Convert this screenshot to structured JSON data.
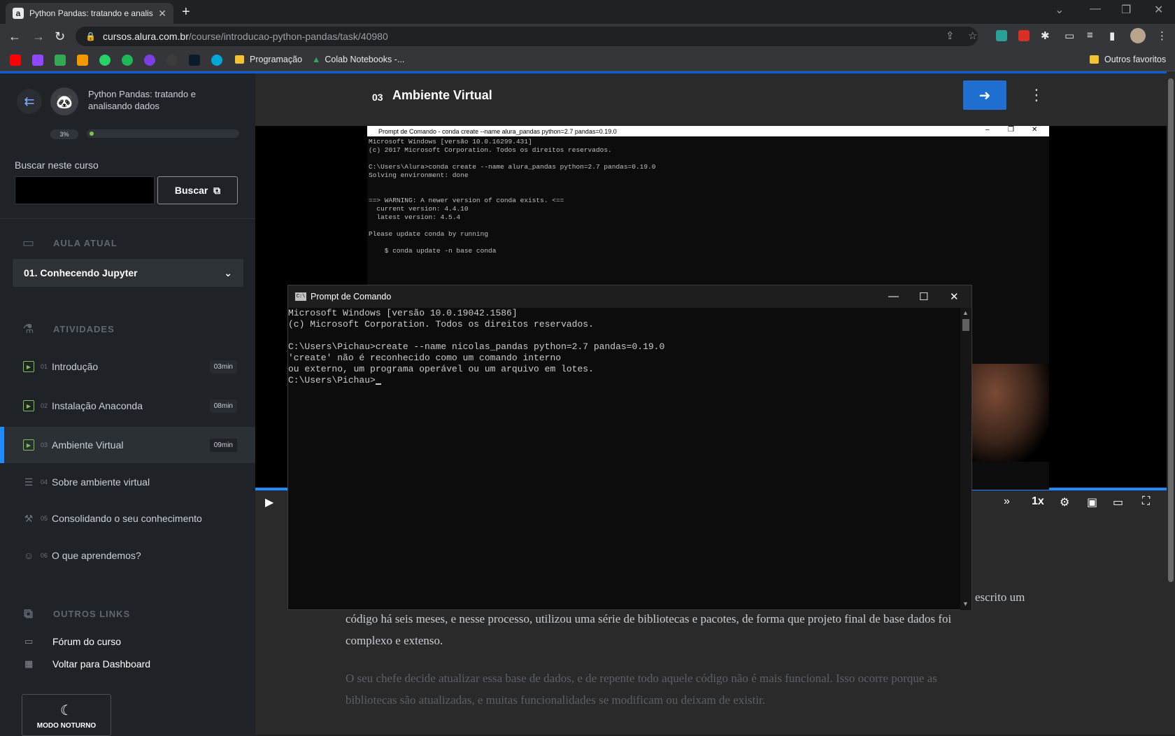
{
  "browser": {
    "tab_title": "Python Pandas: tratando e analis",
    "tab_favicon": "a",
    "url_host": "cursos.alura.com.br",
    "url_path": "/course/introducao-python-pandas/task/40980",
    "bookmarks": [
      {
        "label": "Programação",
        "type": "folder"
      },
      {
        "label": "Colab Notebooks -...",
        "type": "drive"
      }
    ],
    "other_bookmarks": "Outros favoritos"
  },
  "sidebar": {
    "course_title": "Python Pandas: tratando e analisando dados",
    "progress_percent": "3%",
    "progress_value": 0.03,
    "search_label": "Buscar neste curso",
    "search_button": "Buscar",
    "current_lesson_header": "AULA ATUAL",
    "current_lesson": "01. Conhecendo Jupyter",
    "activities_header": "ATIVIDADES",
    "activities": [
      {
        "num": "01",
        "label": "Introdução",
        "duration": "03min",
        "icon": "video-icon"
      },
      {
        "num": "02",
        "label": "Instalação Anaconda",
        "duration": "08min",
        "icon": "video-icon"
      },
      {
        "num": "03",
        "label": "Ambiente Virtual",
        "duration": "09min",
        "icon": "video-icon"
      },
      {
        "num": "04",
        "label": "Sobre ambiente virtual",
        "duration": "",
        "icon": "list-icon"
      },
      {
        "num": "05",
        "label": "Consolidando o seu conhecimento",
        "duration": "",
        "icon": "tools-icon"
      },
      {
        "num": "06",
        "label": "O que aprendemos?",
        "duration": "",
        "icon": "person-check-icon"
      }
    ],
    "other_links_header": "OUTROS LINKS",
    "links": [
      "Fórum do curso",
      "Voltar para Dashboard"
    ],
    "night_mode": "MODO NOTURNO"
  },
  "main": {
    "lesson_number": "03",
    "lesson_title": "Ambiente Virtual",
    "video_speed": "1x",
    "video_progress": 1.0
  },
  "video_console": {
    "title": "Prompt de Comando - conda  create --name alura_pandas python=2.7 pandas=0.19.0",
    "lines": [
      "Microsoft Windows [versão 10.0.16299.431]",
      "(c) 2017 Microsoft Corporation. Todos os direitos reservados.",
      "",
      "C:\\Users\\Alura>conda create --name alura_pandas python=2.7 pandas=0.19.0",
      "Solving environment: done",
      "",
      "",
      "==> WARNING: A newer version of conda exists. <==",
      "  current version: 4.4.10",
      "  latest version: 4.5.4",
      "",
      "Please update conda by running",
      "",
      "    $ conda update -n base conda"
    ]
  },
  "cmd_window": {
    "title": "Prompt de Comando",
    "lines": [
      "Microsoft Windows [versão 10.0.19042.1586]",
      "(c) Microsoft Corporation. Todos os direitos reservados.",
      "",
      "C:\\Users\\Pichau>create --name nicolas_pandas python=2.7 pandas=0.19.0",
      "'create' não é reconhecido como um comando interno",
      "ou externo, um programa operável ou um arquivo em lotes.",
      ""
    ],
    "prompt": "C:\\Users\\Pichau>"
  },
  "article": {
    "p1_tail": "escrito um",
    "p1_line2": "código há seis meses, e nesse processo, utilizou uma série de bibliotecas e pacotes, de forma que projeto final de base dados foi",
    "p1_line3": "complexo e extenso.",
    "p2_line1": "O seu chefe decide atualizar essa base de dados, e de repente todo aquele código não é mais funcional. Isso ocorre porque as",
    "p2_line2": "bibliotecas são atualizadas, e muitas funcionalidades se modificam ou deixam de existir."
  },
  "colors": {
    "accent": "#1f6fd1",
    "progress_green": "#7ec14f",
    "sidebar_bg": "#1f2226"
  }
}
